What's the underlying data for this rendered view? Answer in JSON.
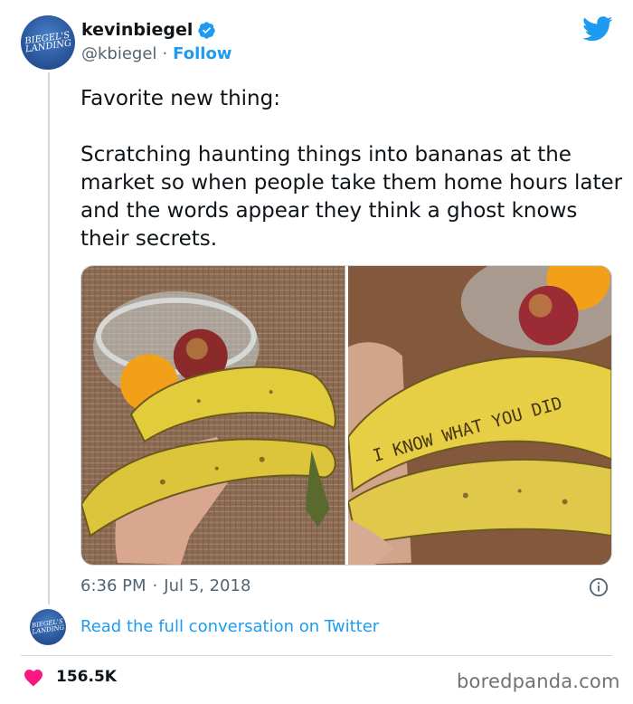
{
  "author": {
    "display_name": "kevinbiegel",
    "handle": "@kbiegel",
    "separator": "·",
    "follow_label": "Follow",
    "avatar_text": "BIEGEL'S LANDING"
  },
  "tweet": {
    "line1": "Favorite new thing:",
    "line2": "Scratching haunting things into bananas at the market so when people take them home hours later and the words appear they think a ghost knows their secrets.",
    "banana_scratch_text": "I KNOW WHAT YOU DID",
    "time": "6:36 PM",
    "separator": "·",
    "date": "Jul 5, 2018"
  },
  "conversation": {
    "link_label": "Read the full conversation on Twitter"
  },
  "engagement": {
    "likes": "156.5K"
  },
  "watermark": "boredpanda.com",
  "icons": {
    "verified": "verified-badge-icon",
    "logo": "twitter-bird-icon",
    "info": "info-icon",
    "heart": "heart-icon"
  },
  "colors": {
    "accent": "#1d9bf0",
    "heart": "#f91880",
    "text": "#0f1419",
    "muted": "#536471"
  }
}
